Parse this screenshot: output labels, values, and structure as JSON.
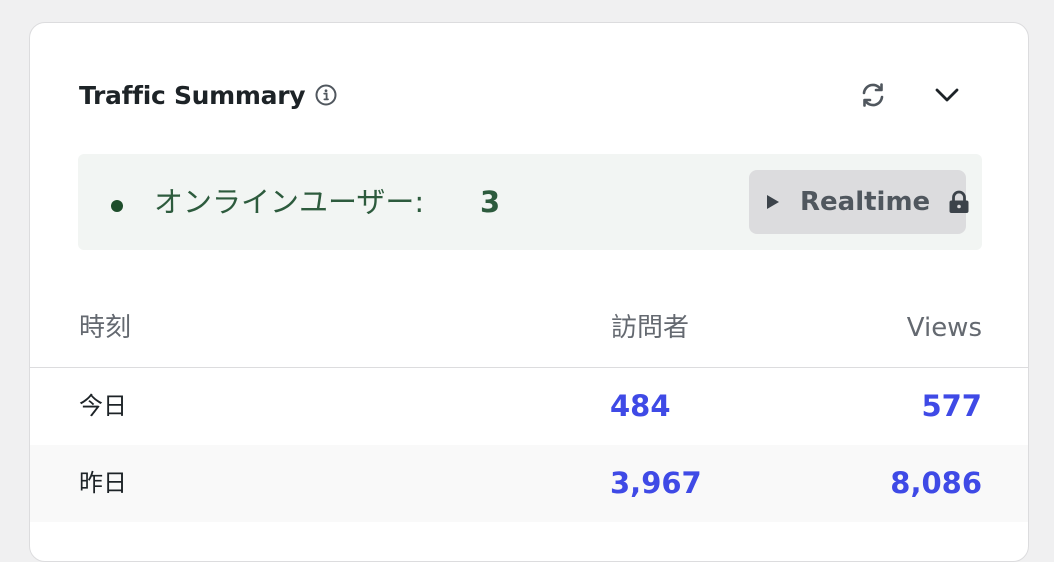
{
  "widget": {
    "title": "Traffic Summary",
    "icons": {
      "info": "info-icon",
      "refresh": "refresh-icon",
      "collapse": "chevron-down-icon"
    }
  },
  "online": {
    "label": "オンラインユーザー:",
    "count": "3",
    "status_color": "#1e4d2b",
    "realtime_button": {
      "label": "Realtime",
      "icon_left": "play-icon",
      "icon_right": "lock-icon"
    }
  },
  "table": {
    "headers": {
      "time": "時刻",
      "visitors": "訪問者",
      "views": "Views"
    },
    "rows": [
      {
        "label": "今日",
        "visitors": "484",
        "views": "577"
      },
      {
        "label": "昨日",
        "visitors": "3,967",
        "views": "8,086"
      }
    ]
  },
  "colors": {
    "accent_link": "#3f4ae6",
    "online_text": "#2d5b3d",
    "online_bg": "#f2f5f3",
    "button_bg": "#dcdcde"
  }
}
